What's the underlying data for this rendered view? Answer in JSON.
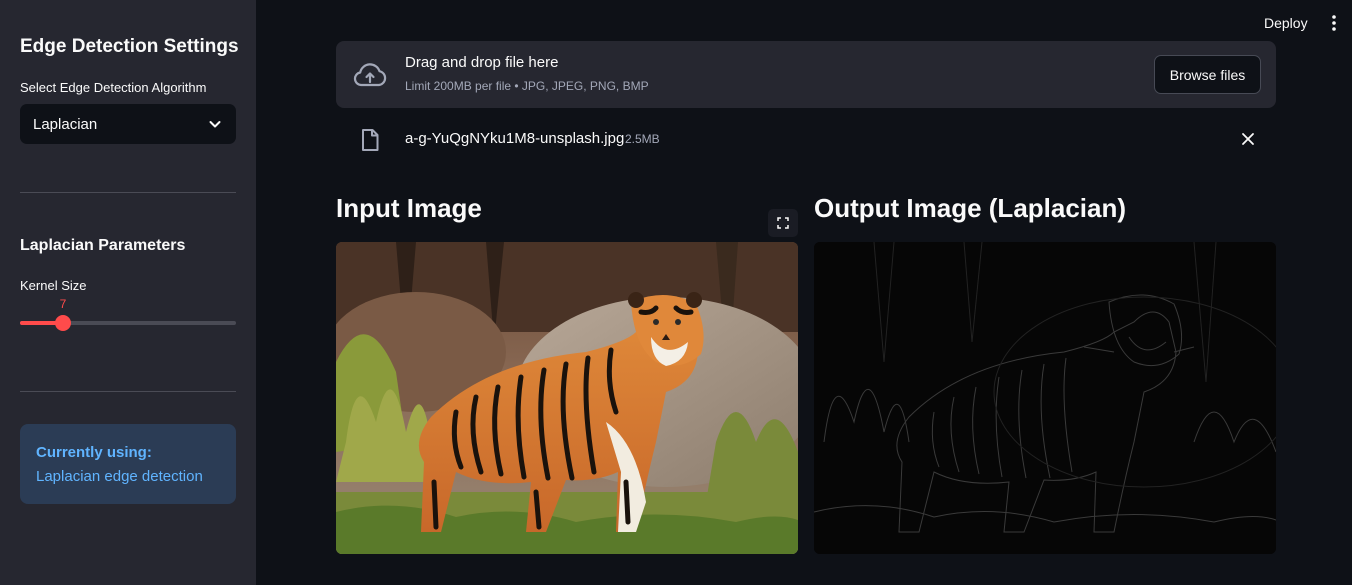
{
  "sidebar": {
    "title": "Edge Detection Settings",
    "algorithm_label": "Select Edge Detection Algorithm",
    "algorithm_value": "Laplacian",
    "params_title": "Laplacian Parameters",
    "kernel_label": "Kernel Size",
    "kernel_value": "7",
    "kernel_fraction": 0.2,
    "info_prefix": "Currently using:",
    "info_text": " Laplacian edge detection"
  },
  "header": {
    "deploy_label": "Deploy",
    "menu_icon": "kebab-menu-icon"
  },
  "uploader": {
    "title": "Drag and drop file here",
    "subtitle": "Limit 200MB per file • JPG, JPEG, PNG, BMP",
    "browse_label": "Browse files",
    "icon": "cloud-upload-icon"
  },
  "file": {
    "name": "a-g-YuQgNYku1M8-unsplash.jpg",
    "size": "2.5MB",
    "icon": "file-icon"
  },
  "main": {
    "input_heading": "Input Image",
    "output_heading": "Output Image (Laplacian)"
  },
  "colors": {
    "background": "#0e1117",
    "sidebar": "#262730",
    "accent": "#ff4b4b",
    "info_bg": "#2b3c55",
    "info_text": "#60b4ff"
  }
}
